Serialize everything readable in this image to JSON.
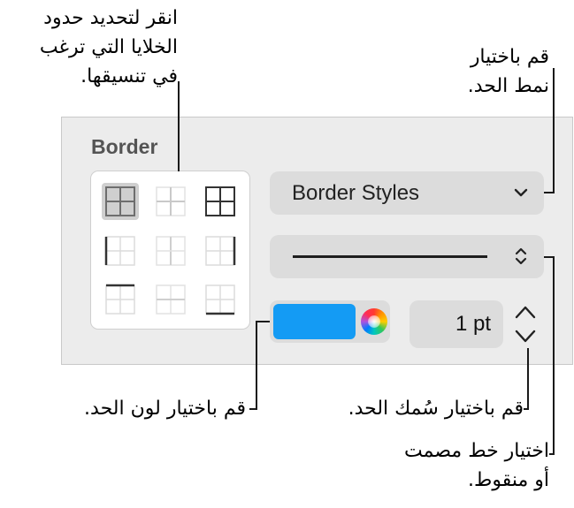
{
  "panel": {
    "title": "Border",
    "border_styles_label": "Border Styles",
    "stroke_width": "1 pt",
    "stroke_color": "#149bf4"
  },
  "callouts": {
    "cells": [
      "انقر لتحديد حدود",
      "الخلايا التي ترغب",
      "في تنسيقها."
    ],
    "style": [
      "قم باختيار",
      "نمط الحد."
    ],
    "color": [
      "قم باختيار لون الحد."
    ],
    "width": [
      "قم باختيار سُمك الحد."
    ],
    "line_type": [
      "اختيار خط مصمت",
      "أو منقوط."
    ]
  },
  "icons": {
    "border_cells": [
      [
        "all-borders-icon",
        "inside-borders-icon",
        "outside-borders-icon"
      ],
      [
        "left-border-icon",
        "inside-vertical-icon",
        "right-border-icon"
      ],
      [
        "top-border-icon",
        "inside-horizontal-icon",
        "bottom-border-icon"
      ]
    ],
    "dropdown": "chevron-down-icon",
    "line_select": "up-down-chevron-icon",
    "stepper_up": "chevron-up-icon",
    "stepper_down": "chevron-down-icon",
    "color_wheel": "color-wheel-icon"
  },
  "selected_cell": "all-borders-icon"
}
